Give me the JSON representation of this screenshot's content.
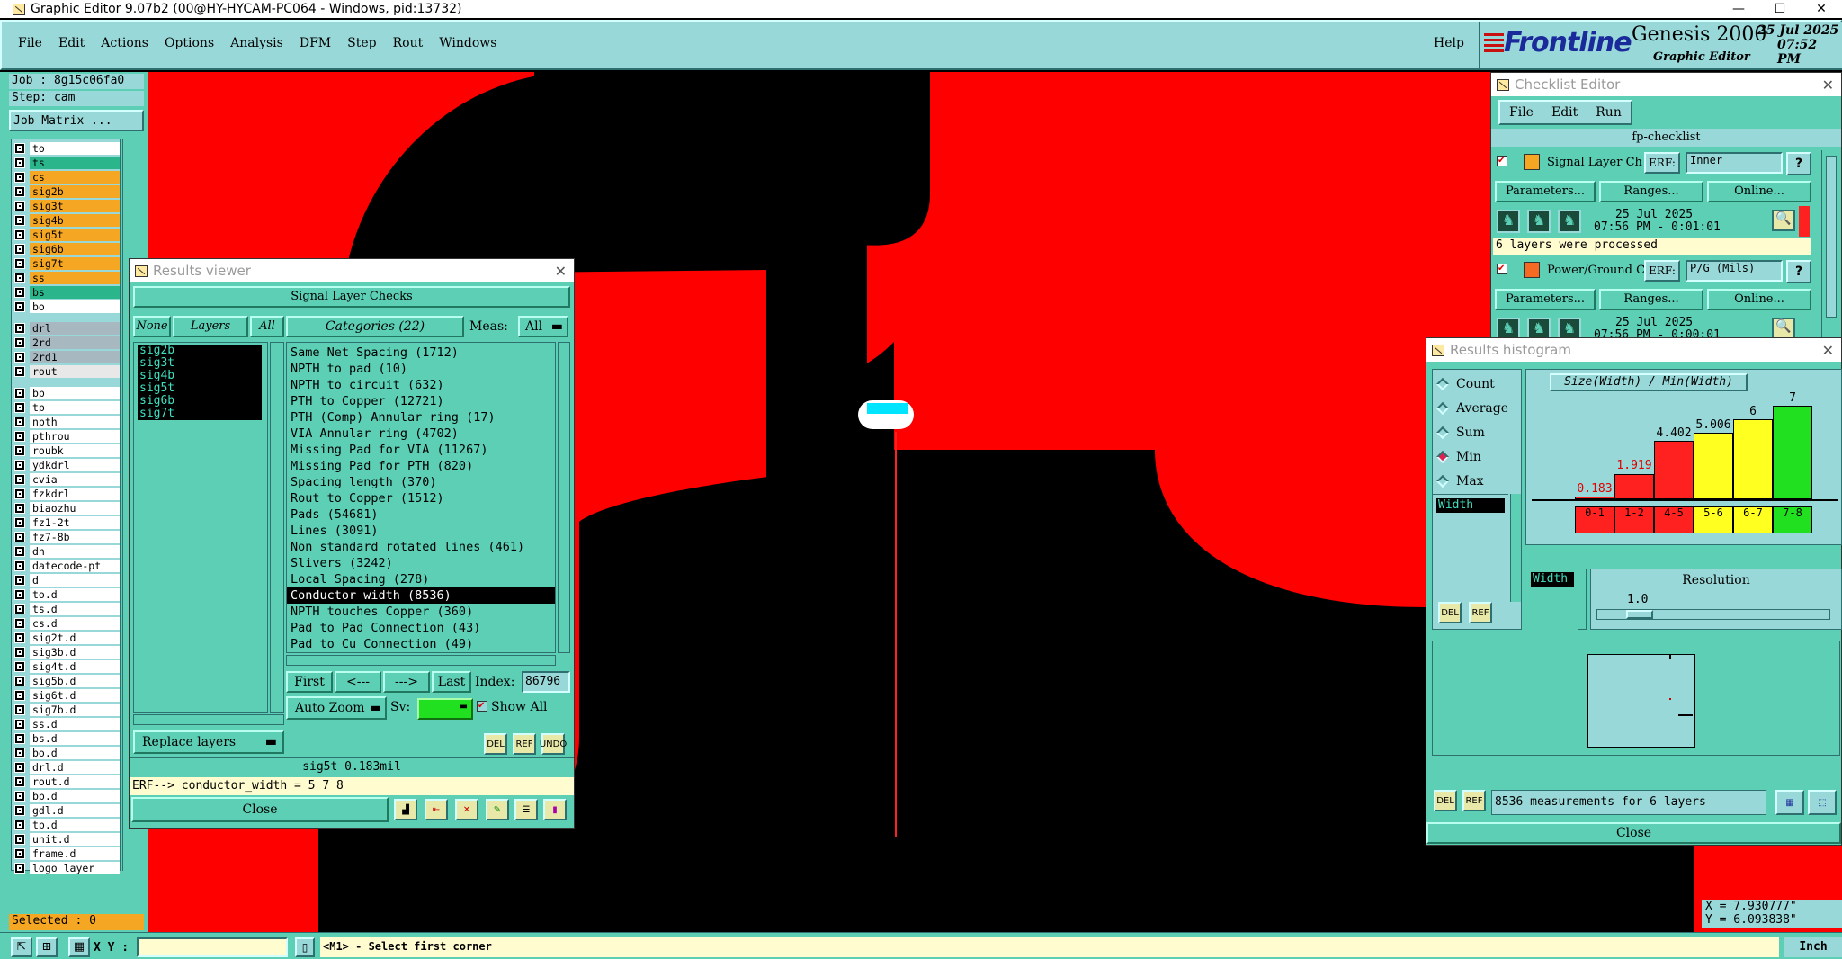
{
  "window": {
    "title": "Graphic Editor 9.07b2 (00@HY-HYCAM-PC064 - Windows, pid:13732)"
  },
  "menubar": {
    "items": [
      "File",
      "Edit",
      "Actions",
      "Options",
      "Analysis",
      "DFM",
      "Step",
      "Rout",
      "Windows"
    ],
    "help": "Help"
  },
  "brand": {
    "logo": "Frontline",
    "product": "Genesis 2000",
    "subtitle": "Graphic Editor",
    "date": "25 Jul 2025",
    "time": "07:52 PM"
  },
  "job": {
    "job_label": "Job : 8g15c06fa0",
    "step_label": "Step: cam",
    "matrix_button": "Job Matrix ...",
    "selected": "Selected : 0"
  },
  "layers": {
    "board": [
      {
        "name": "to",
        "color": "#ffffff"
      },
      {
        "name": "ts",
        "color": "#2ab58a"
      },
      {
        "name": "cs",
        "color": "#f5a623"
      },
      {
        "name": "sig2b",
        "color": "#f5a623"
      },
      {
        "name": "sig3t",
        "color": "#f5a623"
      },
      {
        "name": "sig4b",
        "color": "#f5a623"
      },
      {
        "name": "sig5t",
        "color": "#f5a623"
      },
      {
        "name": "sig6b",
        "color": "#f5a623"
      },
      {
        "name": "sig7t",
        "color": "#f5a623"
      },
      {
        "name": "ss",
        "color": "#f5a623"
      },
      {
        "name": "bs",
        "color": "#2ab58a"
      },
      {
        "name": "bo",
        "color": "#ffffff"
      }
    ],
    "drill": [
      {
        "name": "drl",
        "color": "#a8b8c0"
      },
      {
        "name": "2rd",
        "color": "#a8b8c0"
      },
      {
        "name": "2rd1",
        "color": "#a8b8c0"
      },
      {
        "name": "rout",
        "color": "#e8e8e8"
      }
    ],
    "misc": [
      "bp",
      "tp",
      "npth",
      "pthrou",
      "roubk",
      "ydkdrl",
      "cvia",
      "fzkdrl",
      "biaozhu",
      "fz1-2t",
      "fz7-8b",
      "dh",
      "datecode-pt",
      "d",
      "to.d",
      "ts.d",
      "cs.d",
      "sig2t.d",
      "sig3b.d",
      "sig4t.d",
      "sig5b.d",
      "sig6t.d",
      "sig7b.d",
      "ss.d",
      "bs.d",
      "bo.d",
      "drl.d",
      "rout.d",
      "bp.d",
      "gdl.d",
      "tp.d",
      "unit.d",
      "frame.d",
      "logo_layer"
    ]
  },
  "results_viewer": {
    "title": "Results viewer",
    "header": "Signal Layer Checks",
    "none_btn": "None",
    "layers_btn": "Layers",
    "all_btn": "All",
    "layers": [
      "sig2b",
      "sig3t",
      "sig4b",
      "sig5t",
      "sig6b",
      "sig7t"
    ],
    "categories_label": "Categories (22)",
    "meas_label": "Meas:",
    "meas_value": "All",
    "categories": [
      "Same Net Spacing (1712)",
      "NPTH to pad (10)",
      "NPTH to circuit (632)",
      "PTH to Copper (12721)",
      "PTH (Comp) Annular ring (17)",
      "VIA Annular ring (4702)",
      "Missing Pad for VIA (11267)",
      "Missing Pad for PTH (820)",
      "Spacing length (370)",
      "Rout to Copper (1512)",
      "Pads (54681)",
      "Lines (3091)",
      "Non standard rotated lines (461)",
      "Slivers (3242)",
      "Local Spacing (278)",
      "Conductor width (8536)",
      "NPTH touches Copper (360)",
      "Pad to Pad Connection (43)",
      "Pad to Cu Connection (49)"
    ],
    "selected_category": "Conductor width (8536)",
    "nav": {
      "first": "First",
      "prev": "<---",
      "next": "--->",
      "last": "Last",
      "index_label": "Index:",
      "index_value": "86796"
    },
    "auto_zoom": "Auto Zoom",
    "sv_label": "Sv:",
    "show_all": "Show All",
    "replace_layers": "Replace layers",
    "status": "sig5t 0.183mil",
    "erf": "ERF--> conductor_width = 5 7 8",
    "close": "Close",
    "icons": [
      "del-icon",
      "ref-icon",
      "undo-icon"
    ]
  },
  "checklist": {
    "title": "Checklist Editor",
    "menu": [
      "File",
      "Edit",
      "Run"
    ],
    "name": "fp-checklist",
    "items": [
      {
        "label": "Signal Layer Ch",
        "erf_label": "ERF:",
        "erf_value": "Inner",
        "params": "Parameters...",
        "ranges": "Ranges...",
        "online": "Online...",
        "date": "25 Jul 2025",
        "time": "07:56 PM - 0:01:01",
        "status": "6 layers were processed"
      },
      {
        "label": "Power/Ground C",
        "erf_label": "ERF:",
        "erf_value": "P/G (Mils)",
        "params": "Parameters...",
        "ranges": "Ranges...",
        "online": "Online...",
        "date": "25 Jul 2025",
        "time": "07:56 PM - 0:00:01"
      }
    ],
    "help": "?"
  },
  "histogram": {
    "title": "Results histogram",
    "modes": [
      {
        "label": "Count",
        "on": false
      },
      {
        "label": "Average",
        "on": false
      },
      {
        "label": "Sum",
        "on": false
      },
      {
        "label": "Min",
        "on": true
      },
      {
        "label": "Max",
        "on": false
      }
    ],
    "list_item": "Width",
    "chart_title": "Size(Width) / Min(Width)",
    "resolution_label": "Resolution",
    "resolution_value": "1.0",
    "summary": "8536 measurements for 6 layers",
    "close": "Close"
  },
  "chart_data": {
    "type": "bar",
    "title": "Size(Width) / Min(Width)",
    "categories": [
      "0-1",
      "1-2",
      "4-5",
      "5-6",
      "6-7",
      "7-8"
    ],
    "values": [
      0.183,
      1.919,
      4.402,
      5.006,
      6,
      7
    ],
    "value_labels": [
      "0.183",
      "1.919",
      "4.402",
      "5.006",
      "6",
      "7"
    ],
    "colors": [
      "#ff2020",
      "#ff2020",
      "#ff2020",
      "#ffff20",
      "#ffff20",
      "#20e020"
    ],
    "ylim": [
      0,
      7
    ]
  },
  "coords": {
    "x": "X = 7.930777\"",
    "y": "Y = 6.093838\""
  },
  "statusbar": {
    "xy_label": "X Y :",
    "prompt": "<M1> - Select first corner",
    "units": "Inch"
  }
}
